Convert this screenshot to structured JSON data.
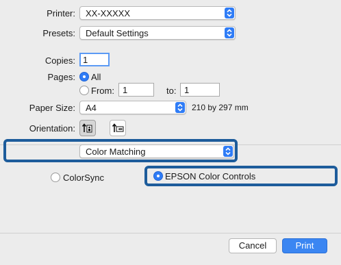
{
  "printer": {
    "label": "Printer:",
    "value": "XX-XXXXX"
  },
  "presets": {
    "label": "Presets:",
    "value": "Default Settings"
  },
  "copies": {
    "label": "Copies:",
    "value": "1"
  },
  "pages": {
    "label": "Pages:",
    "all_label": "All",
    "from_label": "From:",
    "from_value": "1",
    "to_label": "to:",
    "to_value": "1"
  },
  "paper_size": {
    "label": "Paper Size:",
    "value": "A4",
    "dimensions": "210 by 297 mm"
  },
  "orientation": {
    "label": "Orientation:"
  },
  "pane_select": {
    "value": "Color Matching"
  },
  "color_matching": {
    "option_colorsync": "ColorSync",
    "option_epson": "EPSON Color Controls"
  },
  "buttons": {
    "cancel": "Cancel",
    "print": "Print"
  },
  "colors": {
    "accent": "#2f7cf6",
    "highlight_border": "#1d5c9b"
  }
}
